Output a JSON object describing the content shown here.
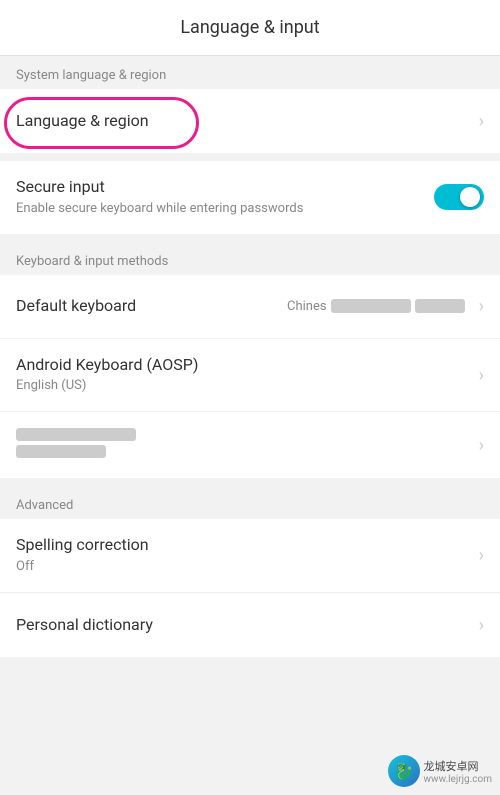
{
  "header": {
    "title": "Language & input"
  },
  "sections": [
    {
      "id": "system-language",
      "header": "System language & region",
      "items": [
        {
          "id": "language-region",
          "title": "Language & region",
          "subtitle": null,
          "hasChevron": true,
          "hasToggle": false,
          "annotated": true
        }
      ]
    },
    {
      "id": "secure-input-group",
      "header": null,
      "items": [
        {
          "id": "secure-input",
          "title": "Secure input",
          "subtitle": "Enable secure keyboard while entering passwords",
          "hasChevron": false,
          "hasToggle": true,
          "toggleOn": true
        }
      ]
    },
    {
      "id": "keyboard-methods",
      "header": "Keyboard & input methods",
      "items": [
        {
          "id": "default-keyboard",
          "title": "Default keyboard",
          "subtitle": null,
          "hasChevron": true,
          "hasToggle": false,
          "valueBlurred": true,
          "valuePrefix": "Chines"
        },
        {
          "id": "android-keyboard",
          "title": "Android Keyboard (AOSP)",
          "subtitle": "English (US)",
          "hasChevron": true,
          "hasToggle": false
        },
        {
          "id": "blurred-keyboard",
          "title": null,
          "subtitle": null,
          "blurredItem": true,
          "hasChevron": true,
          "hasToggle": false
        }
      ]
    },
    {
      "id": "advanced",
      "header": "Advanced",
      "items": [
        {
          "id": "spelling-correction",
          "title": "Spelling correction",
          "subtitle": "Off",
          "hasChevron": true,
          "hasToggle": false
        },
        {
          "id": "personal-dictionary",
          "title": "Personal dictionary",
          "subtitle": null,
          "hasChevron": true,
          "hasToggle": false
        }
      ]
    }
  ],
  "icons": {
    "chevron": "›",
    "toggle_on_color": "#00bcd4"
  }
}
